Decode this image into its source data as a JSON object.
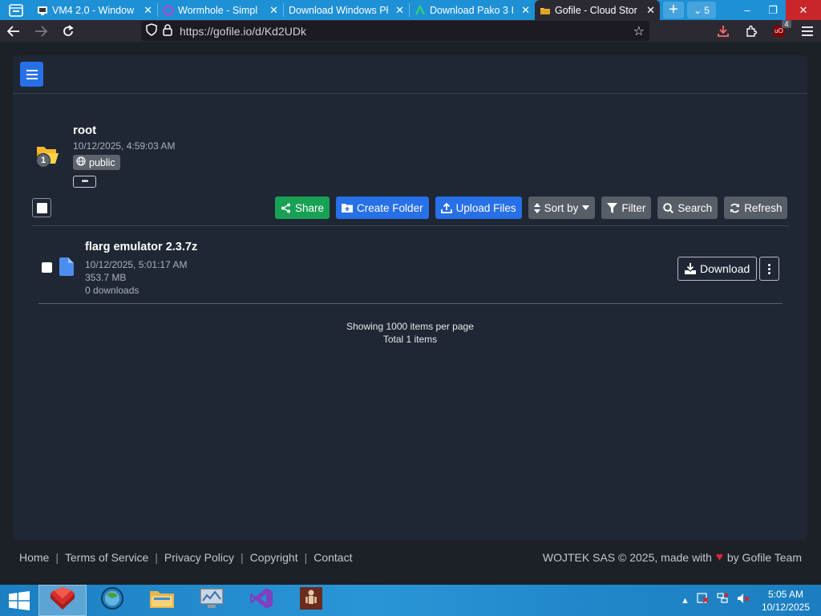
{
  "browser": {
    "tabs": [
      {
        "title": "VM4 2.0 - Window",
        "icon": "vm-icon"
      },
      {
        "title": "Wormhole - Simpl",
        "icon": "wormhole-icon"
      },
      {
        "title": "Download Windows Pł",
        "icon": "none"
      },
      {
        "title": "Download Pako 3 I",
        "icon": "pako-icon"
      },
      {
        "title": "Gofile - Cloud Stor",
        "icon": "gofile-icon",
        "active": true
      }
    ],
    "tab_count": "5",
    "url": "https://gofile.io/d/Kd2UDk",
    "ublock_badge": "4"
  },
  "page": {
    "folder": {
      "name": "root",
      "date": "10/12/2025, 4:59:03 AM",
      "visibility": "public",
      "count": "1",
      "more_label": "•••"
    },
    "toolbar": {
      "share": "Share",
      "create_folder": "Create Folder",
      "upload_files": "Upload Files",
      "sort_by": "Sort by",
      "filter": "Filter",
      "search": "Search",
      "refresh": "Refresh"
    },
    "files": [
      {
        "name": "flarg emulator 2.3.7z",
        "date": "10/12/2025, 5:01:17 AM",
        "size": "353.7 MB",
        "downloads": "0 downloads",
        "download_label": "Download"
      }
    ],
    "paging": {
      "per_page": "Showing 1000 items per page",
      "total": "Total 1 items"
    },
    "footer": {
      "links": [
        "Home",
        "Terms of Service",
        "Privacy Policy",
        "Copyright",
        "Contact"
      ],
      "copyright_prefix": "WOJTEK SAS © 2025, made with",
      "copyright_suffix": "by Gofile Team"
    }
  },
  "taskbar": {
    "apps": [
      "app-red-icon",
      "app-globe-icon",
      "file-explorer-icon",
      "app-monitor-icon",
      "visual-studio-icon",
      "app-figure-icon"
    ],
    "time": "5:05 AM",
    "date": "10/12/2025"
  },
  "colors": {
    "share_green": "#18a155",
    "primary_blue": "#2770e8",
    "secondary_gray": "#565e67",
    "panel_bg": "#1f2734",
    "page_bg": "#1c2027",
    "heart": "#e0243a"
  }
}
